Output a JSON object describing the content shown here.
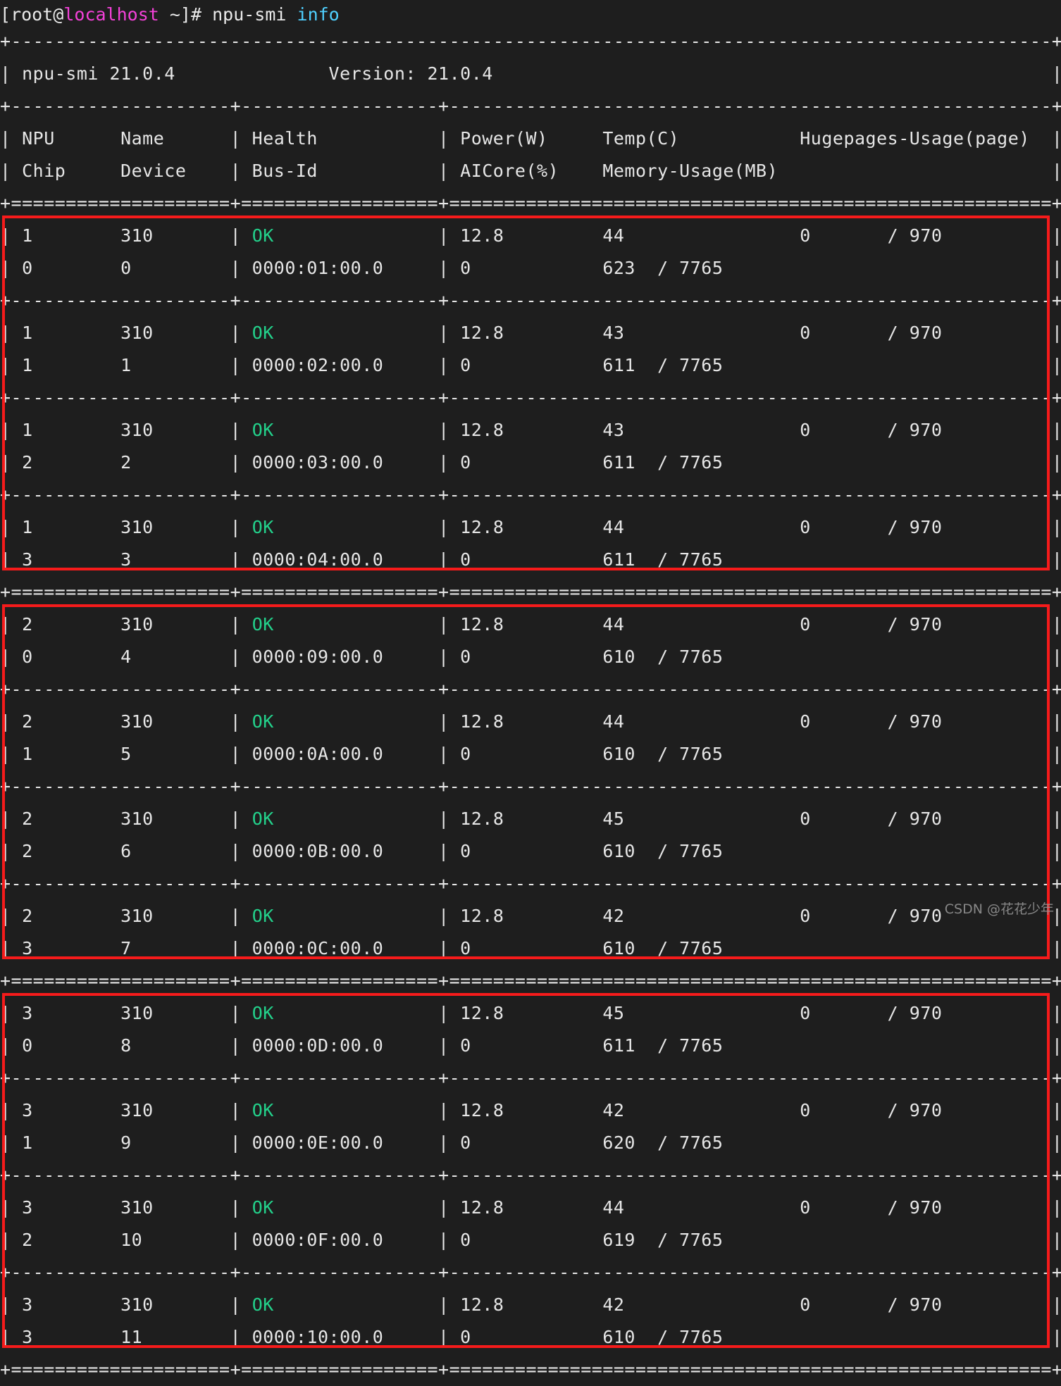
{
  "prompt": {
    "bracket_open": "[",
    "user": "root",
    "at": "@",
    "host": "localhost",
    "path": " ~",
    "bracket_close": "]",
    "sigil": "# ",
    "command": "npu-smi ",
    "subcommand": "info"
  },
  "tool": {
    "name_version": "npu-smi 21.0.4",
    "version_label": "Version: 21.0.4"
  },
  "columns": {
    "row1": [
      "NPU",
      "Name",
      "Health",
      "Power(W)",
      "Temp(C)",
      "Hugepages-Usage(page)"
    ],
    "row2": [
      "Chip",
      "Device",
      "Bus-Id",
      "AICore(%)",
      "Memory-Usage(MB)",
      ""
    ]
  },
  "status_color_ok": "#23d18b",
  "annotation_box_color": "#f61b1b",
  "groups": [
    {
      "npu": "1",
      "rows": [
        {
          "npu": "1",
          "chip": "0",
          "name": "310",
          "device": "0",
          "health": "OK",
          "bus_id": "0000:01:00.0",
          "power": "12.8",
          "aicore": "0",
          "temp": "44",
          "memory_used": "623",
          "memory_total": "7765",
          "hugepages_used": "0",
          "hugepages_total": "970"
        },
        {
          "npu": "1",
          "chip": "1",
          "name": "310",
          "device": "1",
          "health": "OK",
          "bus_id": "0000:02:00.0",
          "power": "12.8",
          "aicore": "0",
          "temp": "43",
          "memory_used": "611",
          "memory_total": "7765",
          "hugepages_used": "0",
          "hugepages_total": "970"
        },
        {
          "npu": "1",
          "chip": "2",
          "name": "310",
          "device": "2",
          "health": "OK",
          "bus_id": "0000:03:00.0",
          "power": "12.8",
          "aicore": "0",
          "temp": "43",
          "memory_used": "611",
          "memory_total": "7765",
          "hugepages_used": "0",
          "hugepages_total": "970"
        },
        {
          "npu": "1",
          "chip": "3",
          "name": "310",
          "device": "3",
          "health": "OK",
          "bus_id": "0000:04:00.0",
          "power": "12.8",
          "aicore": "0",
          "temp": "44",
          "memory_used": "611",
          "memory_total": "7765",
          "hugepages_used": "0",
          "hugepages_total": "970"
        }
      ]
    },
    {
      "npu": "2",
      "rows": [
        {
          "npu": "2",
          "chip": "0",
          "name": "310",
          "device": "4",
          "health": "OK",
          "bus_id": "0000:09:00.0",
          "power": "12.8",
          "aicore": "0",
          "temp": "44",
          "memory_used": "610",
          "memory_total": "7765",
          "hugepages_used": "0",
          "hugepages_total": "970"
        },
        {
          "npu": "2",
          "chip": "1",
          "name": "310",
          "device": "5",
          "health": "OK",
          "bus_id": "0000:0A:00.0",
          "power": "12.8",
          "aicore": "0",
          "temp": "44",
          "memory_used": "610",
          "memory_total": "7765",
          "hugepages_used": "0",
          "hugepages_total": "970"
        },
        {
          "npu": "2",
          "chip": "2",
          "name": "310",
          "device": "6",
          "health": "OK",
          "bus_id": "0000:0B:00.0",
          "power": "12.8",
          "aicore": "0",
          "temp": "45",
          "memory_used": "610",
          "memory_total": "7765",
          "hugepages_used": "0",
          "hugepages_total": "970"
        },
        {
          "npu": "2",
          "chip": "3",
          "name": "310",
          "device": "7",
          "health": "OK",
          "bus_id": "0000:0C:00.0",
          "power": "12.8",
          "aicore": "0",
          "temp": "42",
          "memory_used": "610",
          "memory_total": "7765",
          "hugepages_used": "0",
          "hugepages_total": "970"
        }
      ]
    },
    {
      "npu": "3",
      "rows": [
        {
          "npu": "3",
          "chip": "0",
          "name": "310",
          "device": "8",
          "health": "OK",
          "bus_id": "0000:0D:00.0",
          "power": "12.8",
          "aicore": "0",
          "temp": "45",
          "memory_used": "611",
          "memory_total": "7765",
          "hugepages_used": "0",
          "hugepages_total": "970"
        },
        {
          "npu": "3",
          "chip": "1",
          "name": "310",
          "device": "9",
          "health": "OK",
          "bus_id": "0000:0E:00.0",
          "power": "12.8",
          "aicore": "0",
          "temp": "42",
          "memory_used": "620",
          "memory_total": "7765",
          "hugepages_used": "0",
          "hugepages_total": "970"
        },
        {
          "npu": "3",
          "chip": "2",
          "name": "310",
          "device": "10",
          "health": "OK",
          "bus_id": "0000:0F:00.0",
          "power": "12.8",
          "aicore": "0",
          "temp": "44",
          "memory_used": "619",
          "memory_total": "7765",
          "hugepages_used": "0",
          "hugepages_total": "970"
        },
        {
          "npu": "3",
          "chip": "3",
          "name": "310",
          "device": "11",
          "health": "OK",
          "bus_id": "0000:10:00.0",
          "power": "12.8",
          "aicore": "0",
          "temp": "42",
          "memory_used": "610",
          "memory_total": "7765",
          "hugepages_used": "0",
          "hugepages_total": "970"
        }
      ]
    }
  ],
  "watermark": "CSDN @花花少年"
}
